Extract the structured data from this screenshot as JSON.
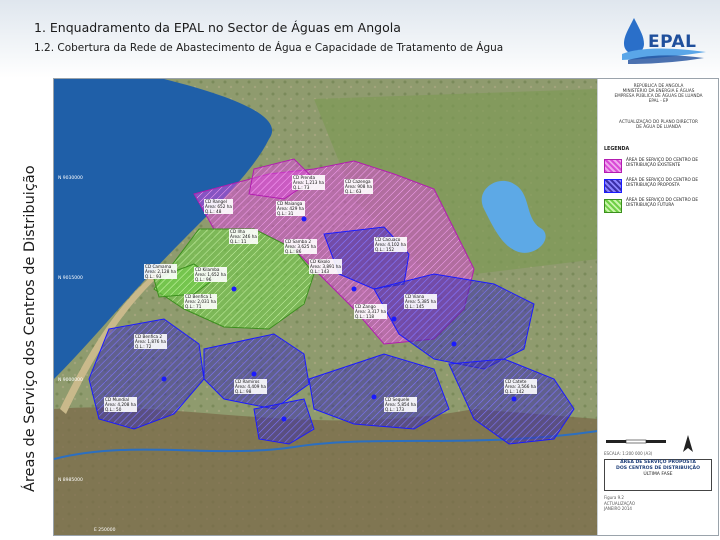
{
  "header": {
    "title": "1. Enquadramento da EPAL no Sector de Águas em Angola",
    "subtitle": "1.2. Cobertura da Rede de Abastecimento de Água e Capacidade de Tratamento de Água",
    "side_label": "Áreas de Serviço dos Centros de Distribuição",
    "logo_text": "EPAL"
  },
  "colors": {
    "existing_area": "#d94ad6",
    "proposed_area": "#3b2fa8",
    "future_area": "#6fcf45",
    "boundary_line": "#1a1aff"
  },
  "legend_panel": {
    "header": [
      "REPÚBLICA DE ANGOLA",
      "MINISTÉRIO DA ENERGIA E ÁGUAS",
      "EMPRESA PÚBLICA DE ÁGUAS DE LUANDA",
      "EPAL - EP"
    ],
    "project": [
      "ACTUALIZAÇÃO DO PLANO DIRECTOR",
      "DE ÁGUA DE LUANDA"
    ],
    "legend_title": "LEGENDA",
    "items": [
      {
        "text": "ÁREA DE SERVIÇO DO CENTRO DE DISTRIBUIÇÃO EXISTENTE",
        "color_key": "existing_area"
      },
      {
        "text": "ÁREA DE SERVIÇO DO CENTRO DE DISTRIBUIÇÃO PROPOSTA",
        "color_key": "proposed_area"
      },
      {
        "text": "ÁREA DE SERVIÇO DO CENTRO DE DISTRIBUIÇÃO FUTURA",
        "color_key": "future_area"
      }
    ],
    "scale_text": "ESCALA: 1:200 000 (A3)",
    "title_box": [
      "ÁREA DE SERVIÇO PROPOSTA",
      "DOS CENTROS DE DISTRIBUIÇÃO",
      "ÚLTIMA FASE"
    ],
    "footer": [
      "Figura 9.2",
      "ACTUALIZAÇÃO",
      "JANEIRO 2014"
    ]
  },
  "map": {
    "coordinate_labels": [
      "N 9030000",
      "N 9015000",
      "N 9000000",
      "N 8985000",
      "E 250000"
    ],
    "zones": [
      {
        "label": "CD Prenda",
        "area": "Área: 1,213 ha",
        "ql": "Q.L.: 73"
      },
      {
        "label": "CD Cazenga",
        "area": "Área: 908 ha",
        "ql": "Q.L.: 63"
      },
      {
        "label": "CD Rangel",
        "area": "Área: 652 ha",
        "ql": "Q.L.: 48"
      },
      {
        "label": "CD Maianga",
        "area": "Área: 429 ha",
        "ql": "Q.L.: 31"
      },
      {
        "label": "CD Ilha",
        "area": "Área: 246 ha",
        "ql": "Q.L.: 11"
      },
      {
        "label": "CD Samba 2",
        "area": "Área: 3,625 ha",
        "ql": "Q.L.: 86"
      },
      {
        "label": "CD Camama",
        "area": "Área: 2,128 ha",
        "ql": "Q.L.: 93"
      },
      {
        "label": "CD Kilamba",
        "area": "Área: 1,652 ha",
        "ql": "Q.L.: 96"
      },
      {
        "label": "CD Cacuaco",
        "area": "Área: 4,102 ha",
        "ql": "Q.L.: 152"
      },
      {
        "label": "CD Kikolo",
        "area": "Área: 3,891 ha",
        "ql": "Q.L.: 143"
      },
      {
        "label": "CD Viana",
        "area": "Área: 5,385 ha",
        "ql": "Q.L.: 145"
      },
      {
        "label": "CD Zango",
        "area": "Área: 3,317 ha",
        "ql": "Q.L.: 118"
      },
      {
        "label": "CD Benfica 1",
        "area": "Área: 2,031 ha",
        "ql": "Q.L.: 71"
      },
      {
        "label": "CD Benfica 2",
        "area": "Área: 1,876 ha",
        "ql": "Q.L.: 72"
      },
      {
        "label": "CD Mundial",
        "area": "Área: 4,208 ha",
        "ql": "Q.L.: 50"
      },
      {
        "label": "CD Ramiros",
        "area": "Área: 4,409 ha",
        "ql": "Q.L.: 98"
      },
      {
        "label": "CD Sequele",
        "area": "Área: 5,854 ha",
        "ql": "Q.L.: 173"
      },
      {
        "label": "CD Catete",
        "area": "Área: 3,566 ha",
        "ql": "Q.L.: 142"
      }
    ]
  }
}
